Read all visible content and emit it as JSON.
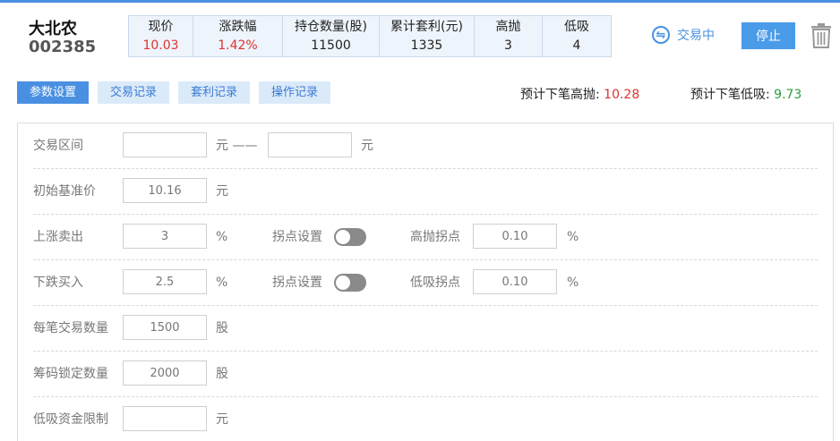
{
  "stock": {
    "name": "大北农",
    "code": "002385"
  },
  "stats": [
    {
      "label": "现价",
      "value": "10.03",
      "highlight": true
    },
    {
      "label": "涨跌幅",
      "value": "1.42%",
      "highlight": true
    },
    {
      "label": "持仓数量(股)",
      "value": "11500",
      "highlight": false
    },
    {
      "label": "累计套利(元)",
      "value": "1335",
      "highlight": false
    },
    {
      "label": "高抛",
      "value": "3",
      "highlight": false
    },
    {
      "label": "低吸",
      "value": "4",
      "highlight": false
    }
  ],
  "header": {
    "trade_status": "交易中",
    "stop_label": "停止"
  },
  "tabs": [
    {
      "label": "参数设置",
      "active": true
    },
    {
      "label": "交易记录",
      "active": false
    },
    {
      "label": "套利记录",
      "active": false
    },
    {
      "label": "操作记录",
      "active": false
    }
  ],
  "forecast": {
    "sell_label": "预计下笔高抛:",
    "sell_value": "10.28",
    "buy_label": "预计下笔低吸:",
    "buy_value": "9.73"
  },
  "form": {
    "range": {
      "label": "交易区间",
      "low": "",
      "high": "",
      "unit": "元 ——",
      "unit2": "元"
    },
    "base_price": {
      "label": "初始基准价",
      "value": "10.16",
      "unit": "元"
    },
    "rise_sell": {
      "label": "上涨卖出",
      "value": "3",
      "unit": "%",
      "turn_label": "拐点设置",
      "turn_on": false,
      "point_label": "高抛拐点",
      "point_value": "0.10",
      "point_unit": "%"
    },
    "fall_buy": {
      "label": "下跌买入",
      "value": "2.5",
      "unit": "%",
      "turn_label": "拐点设置",
      "turn_on": false,
      "point_label": "低吸拐点",
      "point_value": "0.10",
      "point_unit": "%"
    },
    "trade_qty": {
      "label": "每笔交易数量",
      "value": "1500",
      "unit": "股"
    },
    "lock_qty": {
      "label": "筹码锁定数量",
      "value": "2000",
      "unit": "股"
    },
    "buy_limit": {
      "label": "低吸资金限制",
      "value": "",
      "unit": "元"
    }
  },
  "colors": {
    "accent": "#4a90e2",
    "up": "#e0322f",
    "down": "#2e9e3e"
  }
}
